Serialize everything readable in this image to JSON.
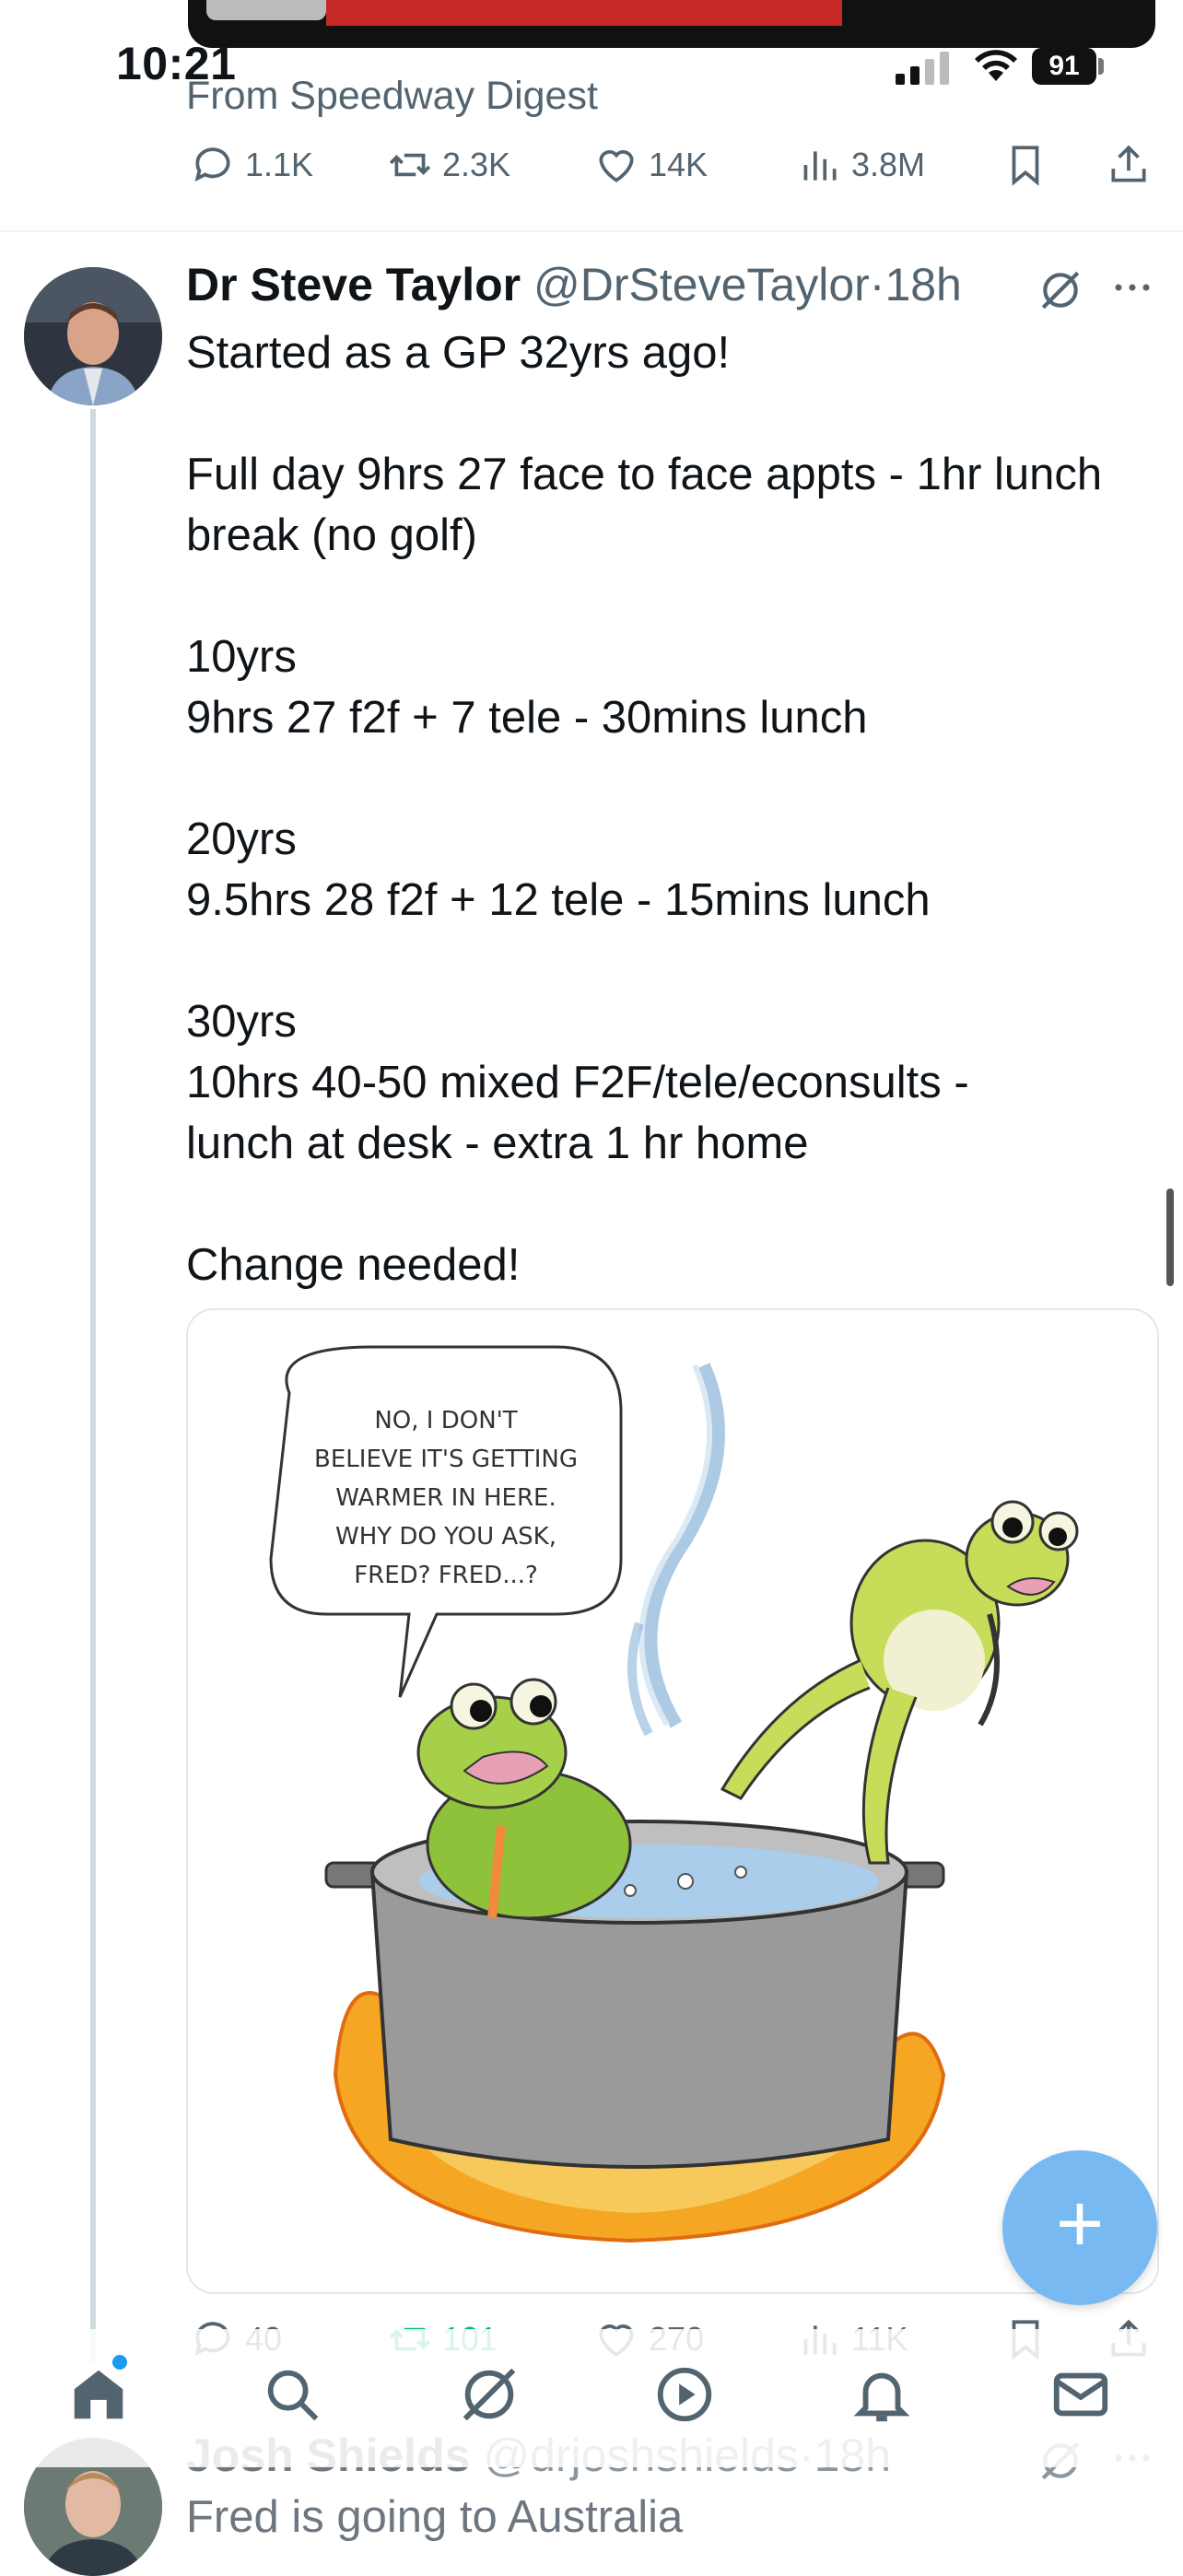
{
  "status_bar": {
    "time": "10:21",
    "battery": "91"
  },
  "prev_tweet": {
    "source_label": "From Speedway Digest",
    "replies": "1.1K",
    "reposts": "2.3K",
    "likes": "14K",
    "views": "3.8M"
  },
  "tweet": {
    "author_name": "Dr Steve Taylor",
    "handle": "@DrSteveTaylor",
    "separator": "·",
    "time_ago": "18h",
    "paragraphs": [
      [
        "Started as a GP 32yrs ago!"
      ],
      [
        "Full day 9hrs 27 face to face appts - 1hr lunch",
        "break (no golf)"
      ],
      [
        "10yrs",
        "9hrs 27 f2f + 7 tele - 30mins lunch"
      ],
      [
        "20yrs",
        "9.5hrs 28 f2f + 12 tele - 15mins lunch"
      ],
      [
        "30yrs",
        "10hrs 40-50 mixed F2F/tele/econsults -",
        "lunch at desk - extra 1 hr home"
      ],
      [
        "Change needed!"
      ]
    ],
    "image_speech_bubble": [
      "NO, I DON'T",
      "BELIEVE IT'S GETTING",
      "WARMER IN HERE.",
      "WHY DO YOU ASK,",
      "FRED? FRED...?"
    ],
    "replies": "40",
    "reposts": "101",
    "likes": "270",
    "views": "11K"
  },
  "next_tweet": {
    "author_name": "Josh Shields",
    "handle": "@drjoshshields",
    "separator": "·",
    "time_ago": "18h",
    "text": "Fred is going to Australia"
  },
  "bottom_nav": [
    "home-icon",
    "search-icon",
    "grok-icon",
    "video-icon",
    "notifications-icon",
    "messages-icon"
  ],
  "colors": {
    "accent": "#1d9bf0",
    "repost_active": "#00ba7c",
    "secondary_text": "#536471",
    "fab": "#78b9f2"
  }
}
